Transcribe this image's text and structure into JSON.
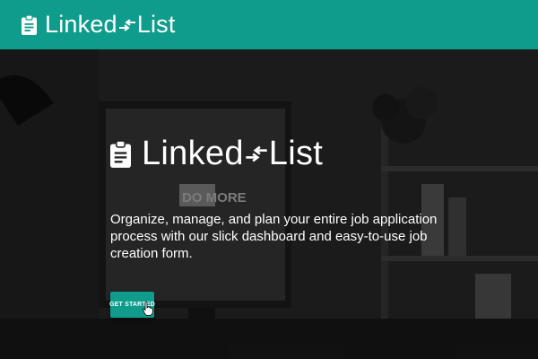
{
  "navbar": {
    "brand_left": "Linked",
    "brand_right": "List",
    "logo_icon": "clipboard-icon",
    "arrows_icon": "swap-arrows-icon"
  },
  "hero": {
    "logo_left": "Linked",
    "logo_right": "List",
    "tagline": "Organize, manage, and plan your entire job application process with our slick dashboard and easy-to-use job creation form.",
    "cta_label": "GET STARTED",
    "background_text": "DO MORE"
  },
  "colors": {
    "accent": "#0f9c8c",
    "text": "#ffffff"
  }
}
